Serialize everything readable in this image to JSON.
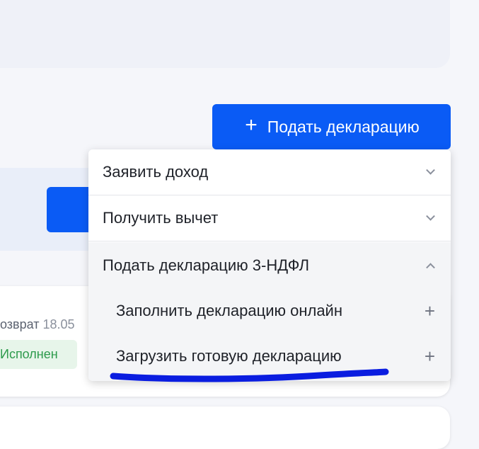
{
  "submit_button": {
    "icon": "plus-icon",
    "label": "Подать декларацию",
    "color": "#0a5bf5"
  },
  "left_card": {
    "text_partial": "озврат",
    "date_partial": "18.05",
    "status": "Исполнен",
    "status_color": "#2c9a4b"
  },
  "dropdown": {
    "items": [
      {
        "label": "Заявить доход",
        "icon": "chevron-down-icon"
      },
      {
        "label": "Получить вычет",
        "icon": "chevron-down-icon"
      },
      {
        "label": "Подать декларацию 3-НДФЛ",
        "icon": "chevron-up-icon",
        "expanded": true,
        "children": [
          {
            "label": "Заполнить декларацию онлайн",
            "icon": "plus-icon"
          },
          {
            "label": "Загрузить готовую декларацию",
            "icon": "plus-icon",
            "highlighted": true
          }
        ]
      }
    ]
  },
  "annotation": {
    "type": "hand-drawn underline",
    "color": "#0a1de0"
  }
}
